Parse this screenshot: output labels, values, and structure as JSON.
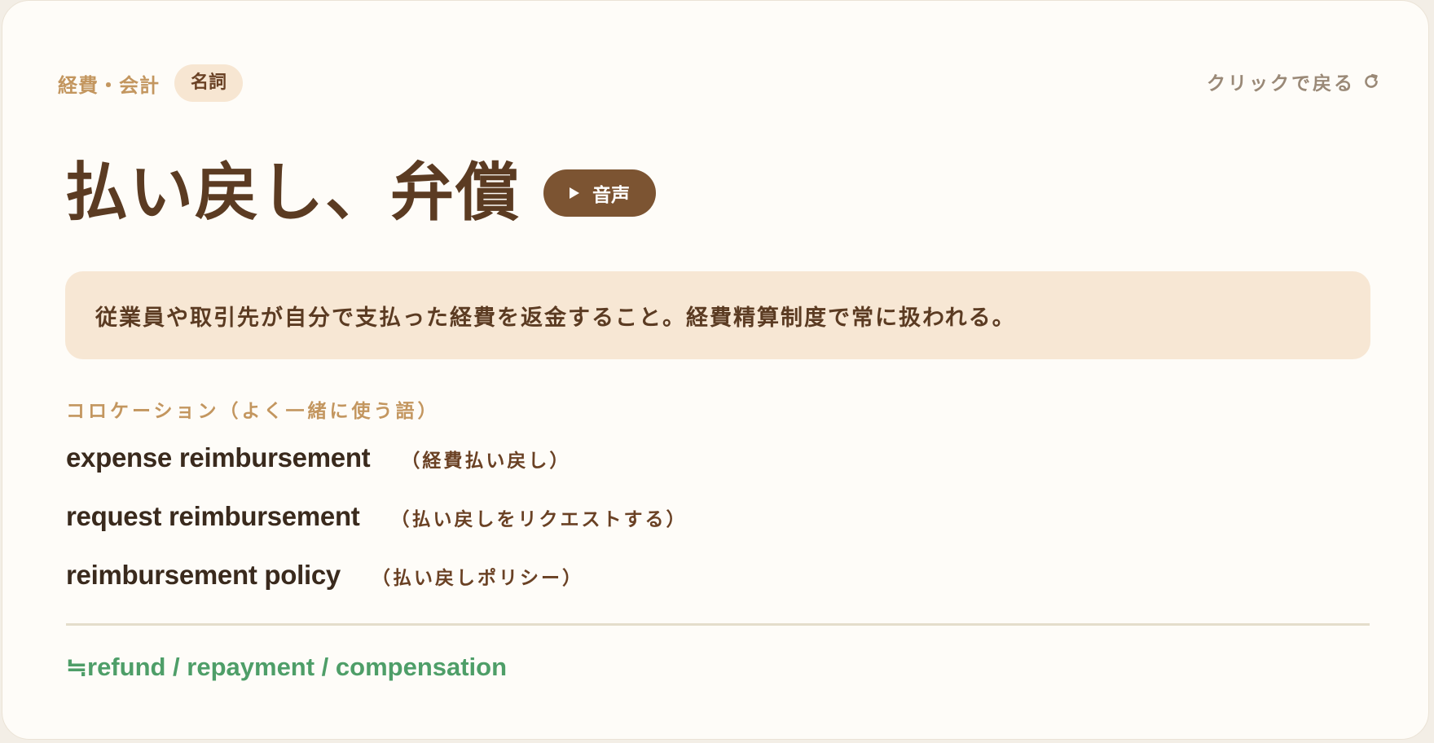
{
  "card": {
    "category": "経費・会計",
    "part_of_speech": "名詞",
    "back_label": "クリックで戻る",
    "back_icon": "refresh-icon",
    "term": "払い戻し、弁償",
    "audio_label": "音声",
    "audio_icon": "play-icon",
    "definition": "従業員や取引先が自分で支払った経費を返金すること。経費精算制度で常に扱われる。",
    "collocations_label": "コロケーション（よく一緒に使う語）",
    "collocations": [
      {
        "en": "expense reimbursement",
        "ja": "（経費払い戻し）"
      },
      {
        "en": "request reimbursement",
        "ja": "（払い戻しをリクエストする）"
      },
      {
        "en": "reimbursement policy",
        "ja": "（払い戻しポリシー）"
      }
    ],
    "synonyms": "≒refund / repayment / compensation"
  },
  "colors": {
    "accent": "#7c5432",
    "title": "#5b3b22",
    "label": "#c3965f",
    "definition_bg": "#f7e7d4",
    "synonym": "#4e9e68"
  }
}
